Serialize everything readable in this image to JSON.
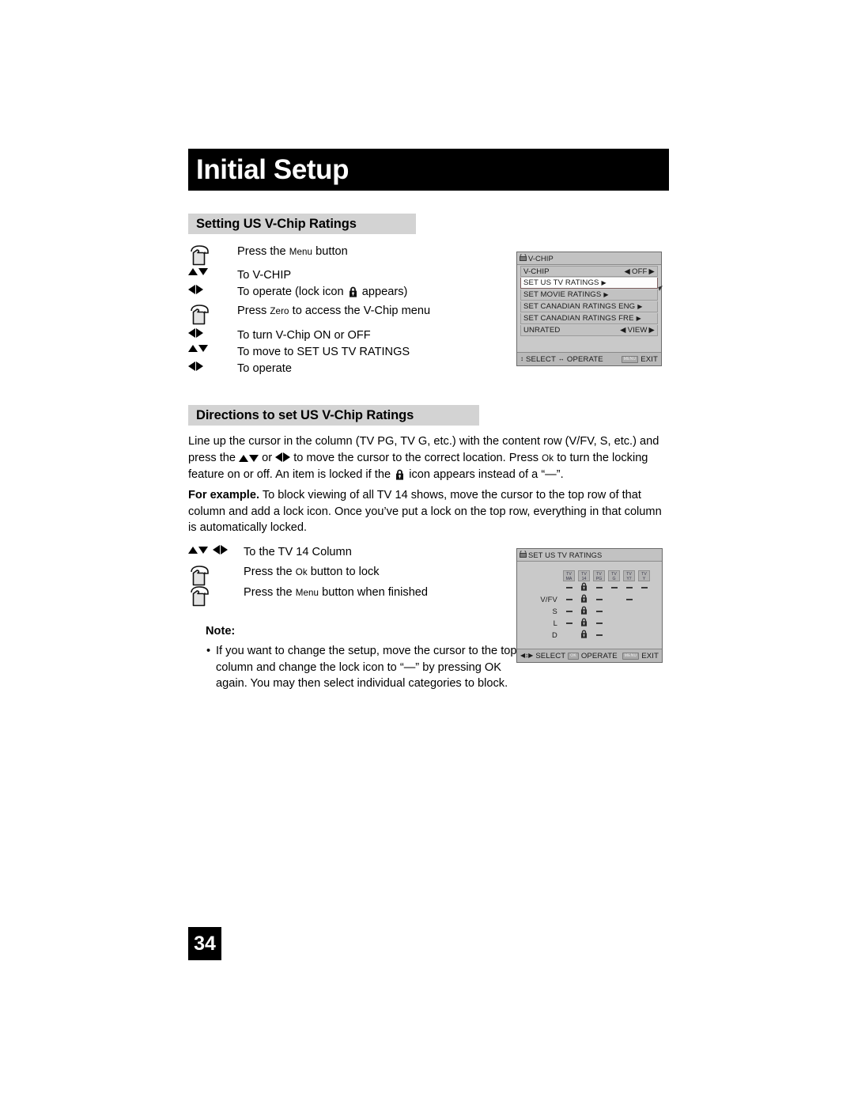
{
  "page": {
    "title": "Initial Setup",
    "number": "34"
  },
  "sections": [
    {
      "heading": "Setting US V-Chip Ratings"
    },
    {
      "heading": "Directions to set US V-Chip Ratings"
    }
  ],
  "steps_top": [
    {
      "icon": "hand-press-icon",
      "text_pre": "Press the ",
      "smallcaps": "Menu",
      "text_post": " button"
    },
    {
      "icon": "up-down-arrows-icon",
      "text_pre": "To V-CHIP",
      "smallcaps": "",
      "text_post": ""
    },
    {
      "icon": "left-right-arrows-icon",
      "text_pre": "To operate (lock icon ",
      "smallcaps": "",
      "text_post": " appears)",
      "has_lock": true
    },
    {
      "icon": "hand-press-icon",
      "text_pre": "Press ",
      "smallcaps": "Zero",
      "text_post": " to access the V-Chip menu"
    },
    {
      "icon": "left-right-arrows-icon",
      "text_pre": "To turn V-Chip ON or OFF",
      "smallcaps": "",
      "text_post": ""
    },
    {
      "icon": "up-down-arrows-icon",
      "text_pre": "To move to SET US TV RATINGS",
      "smallcaps": "",
      "text_post": ""
    },
    {
      "icon": "left-right-arrows-icon",
      "text_pre": "To operate",
      "smallcaps": "",
      "text_post": ""
    }
  ],
  "steps_bottom": [
    {
      "icon": "up-down-left-right-arrows-icon",
      "text_pre": "To the TV 14 Column",
      "smallcaps": "",
      "text_post": ""
    },
    {
      "icon": "hand-press-icon",
      "text_pre": "Press the ",
      "smallcaps": "Ok",
      "text_post": " button to lock"
    },
    {
      "icon": "hand-press-icon",
      "text_pre": "Press the ",
      "smallcaps": "Menu",
      "text_post": " button when finished"
    }
  ],
  "paragraphs": {
    "directions_1a": "Line up the cursor in the column (TV PG, TV G, etc.) with the content row (V/FV, S, etc.) and press the ",
    "directions_1b": " or ",
    "directions_1c": " to move the cursor to the correct location. Press ",
    "directions_1_ok": "Ok",
    "directions_1d": " to turn the locking feature on or off. An item is locked if the ",
    "directions_1e": " icon appears instead of a “—”.",
    "example_bold": "For example.",
    "example_rest": " To block viewing of all TV 14 shows, move the cursor to the top row of that column and add a lock icon. Once you’ve put a lock on the top row, everything in that column is automatically locked."
  },
  "note": {
    "title": "Note:",
    "bullet": "•",
    "items": [
      "If you want to change the setup, move the cursor to the top column and change the lock icon to “—” by pressing OK again. You may then select individual categories to block."
    ]
  },
  "osd_vchip": {
    "title": "V-CHIP",
    "title_icon": "tv-icon",
    "rows": [
      {
        "label": "V-CHIP",
        "value": "OFF",
        "type": "value",
        "selected": false
      },
      {
        "label": "SET US TV RATINGS",
        "value": "",
        "type": "submenu",
        "selected": true
      },
      {
        "label": "SET MOVIE RATINGS",
        "value": "",
        "type": "submenu",
        "selected": false
      },
      {
        "label": "SET CANADIAN RATINGS ENG",
        "value": "",
        "type": "submenu",
        "selected": false
      },
      {
        "label": "SET CANADIAN RATINGS FRE",
        "value": "",
        "type": "submenu",
        "selected": false
      },
      {
        "label": "UNRATED",
        "value": "VIEW",
        "type": "value",
        "selected": false
      }
    ],
    "footer": {
      "select_label": "SELECT",
      "operate_label": "OPERATE",
      "exit_key": "MENU",
      "exit_label": "EXIT"
    }
  },
  "osd_ratings": {
    "title": "SET US TV RATINGS",
    "title_icon": "tv-icon",
    "columns": [
      {
        "top": "TV",
        "bottom": "MA"
      },
      {
        "top": "TV",
        "bottom": "14"
      },
      {
        "top": "TV",
        "bottom": "PG"
      },
      {
        "top": "TV",
        "bottom": "G"
      },
      {
        "top": "TV",
        "bottom": "Y7"
      },
      {
        "top": "TV",
        "bottom": "Y"
      }
    ],
    "rows": [
      {
        "label": "",
        "cells": [
          "dash",
          "lock",
          "dash",
          "dash",
          "dash",
          "dash"
        ]
      },
      {
        "label": "V/FV",
        "cells": [
          "dash",
          "lock",
          "dash",
          "",
          "dash",
          ""
        ]
      },
      {
        "label": "S",
        "cells": [
          "dash",
          "lock",
          "dash",
          "",
          "",
          ""
        ]
      },
      {
        "label": "L",
        "cells": [
          "dash",
          "lock",
          "dash",
          "",
          "",
          ""
        ]
      },
      {
        "label": "D",
        "cells": [
          "",
          "lock",
          "dash",
          "",
          "",
          ""
        ]
      }
    ],
    "footer": {
      "select_label": "SELECT",
      "operate_key": "OK",
      "operate_label": "OPERATE",
      "exit_key": "MENU",
      "exit_label": "EXIT"
    }
  },
  "colors": {
    "title_bar": "#000000",
    "heading_band": "#d3d3d3",
    "osd_body": "#c9c9c9",
    "osd_row": "#c2c2c2",
    "osd_selected": "#fdfdfd"
  }
}
